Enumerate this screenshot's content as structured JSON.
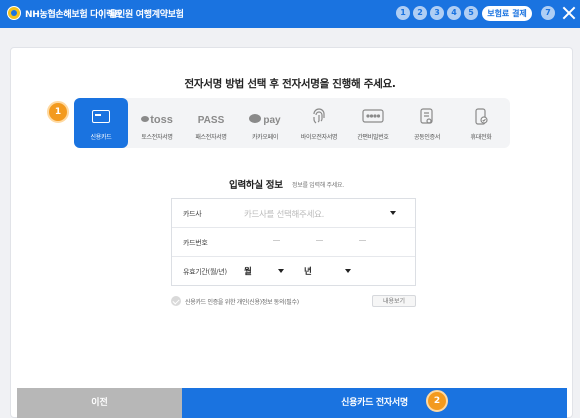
{
  "header": {
    "brand": "NH농협손해보험 다이렉트",
    "product": "올인원 여행계약보험",
    "steps": [
      "1",
      "2",
      "3",
      "4",
      "5"
    ],
    "pay_button": "보험료 결제",
    "step_last": "7"
  },
  "main_title": "전자서명 방법 선택 후 전자서명을 진행해 주세요.",
  "methods": [
    {
      "label": "신용카드",
      "icon": "card-icon",
      "active": true
    },
    {
      "label": "토스전자서명",
      "icon": "toss-icon",
      "icon_text": "toss"
    },
    {
      "label": "패스전자서명",
      "icon": "pass-icon",
      "icon_text": "PASS"
    },
    {
      "label": "카카오페이",
      "icon": "kakaopay-icon",
      "icon_text": "pay"
    },
    {
      "label": "바이오전자서명",
      "icon": "fingerprint-icon"
    },
    {
      "label": "간편비밀번호",
      "icon": "password-icon"
    },
    {
      "label": "공동인증서",
      "icon": "certificate-icon"
    },
    {
      "label": "휴대전화",
      "icon": "phone-icon"
    }
  ],
  "badges": {
    "method": "1",
    "submit": "2"
  },
  "form": {
    "title": "입력하실 정보",
    "subtitle": "정보를 입력해 주세요.",
    "card_company_label": "카드사",
    "card_company_placeholder": "카드사를 선택해주세요.",
    "card_number_label": "카드번호",
    "expiry_label": "유효기간(월/년)",
    "month_label": "월",
    "year_label": "년"
  },
  "agreement": {
    "text": "신용카드 인증을 위한 개인(신용)정보 동의(필수)",
    "view_button": "내용보기"
  },
  "footer": {
    "prev_button": "이전",
    "next_button": "신용카드 전자서명"
  },
  "colors": {
    "primary": "#1a73e0",
    "badge": "#f39a1e",
    "disabled": "#b7b7b7"
  }
}
